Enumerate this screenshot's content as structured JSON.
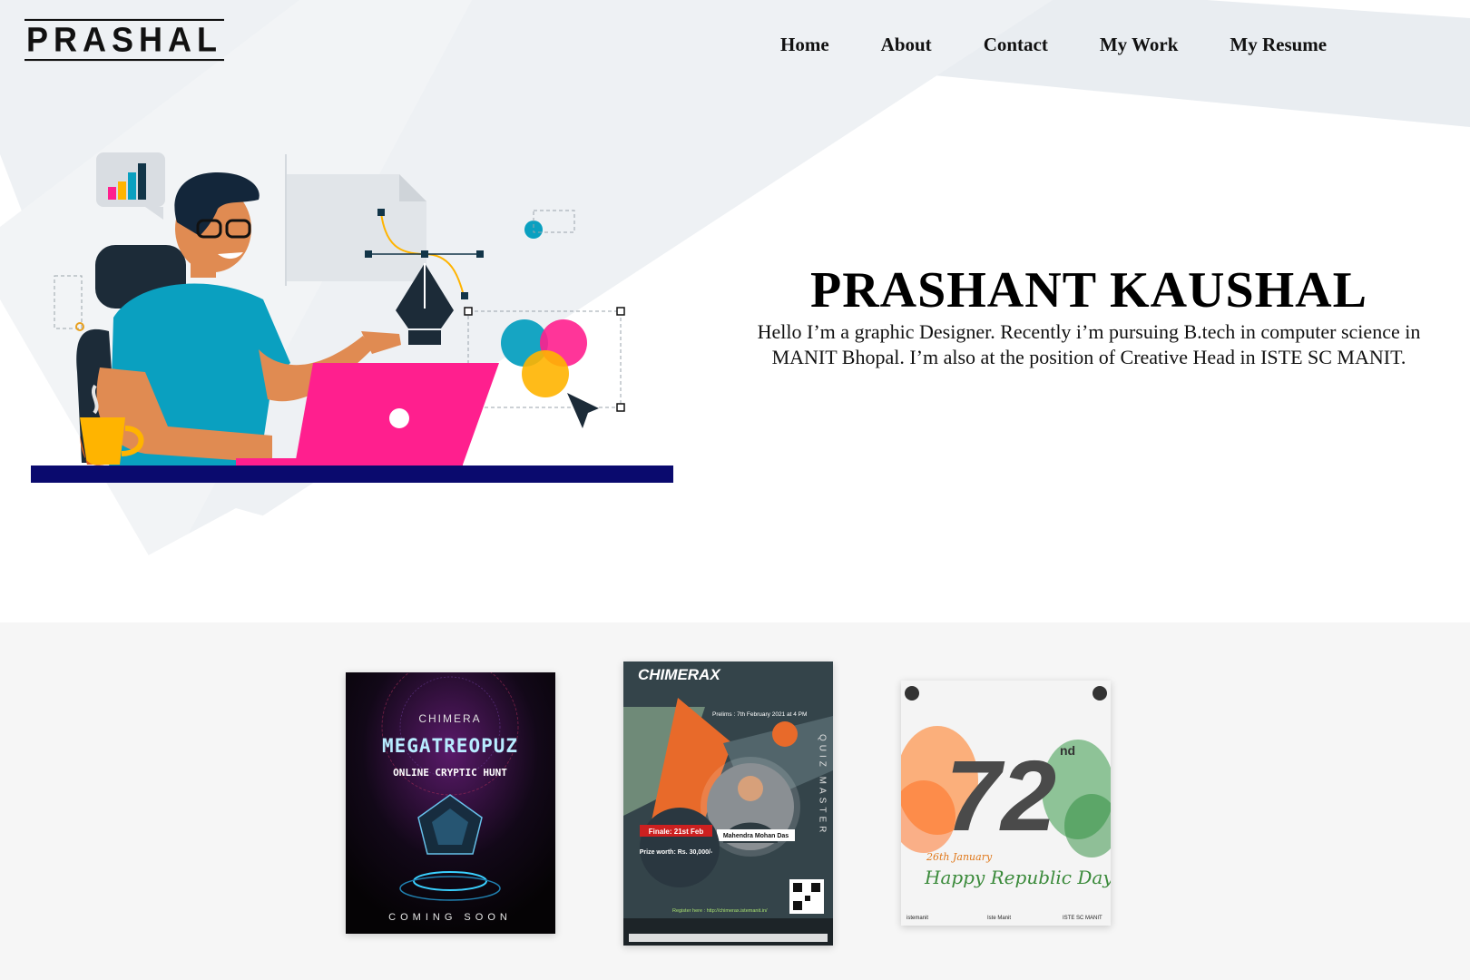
{
  "brand": {
    "logo": "PRASHAL"
  },
  "nav": {
    "items": [
      "Home",
      "About",
      "Contact",
      "My Work",
      "My Resume"
    ]
  },
  "hero": {
    "title": "PRASHANT KAUSHAL",
    "description": "Hello I’m a graphic Designer. Recently i’m pursuing B.tech in computer science in MANIT Bhopal. I’m also at the position of Creative Head in ISTE SC MANIT."
  },
  "gallery": {
    "items": [
      {
        "alt": "Chimera MegaTreoPuz poster",
        "event": "CHIMERA",
        "title": "MEGATREOPUZ",
        "subtitle": "ONLINE CRYPTIC HUNT",
        "footer": "COMING SOON"
      },
      {
        "alt": "ChimeraX Quiz Master poster",
        "event": "CHIMERAX",
        "prelims": "Prelims : 7th February 2021 at 4 PM",
        "vertical": "QUIZ MASTER",
        "finale": "Finale: 21st Feb",
        "prize": "Prize worth: Rs. 30,000/-",
        "speaker": "Mahendra Mohan Das",
        "register": "Register here : http://chimerax.istemanit.in/"
      },
      {
        "alt": "72nd Republic Day poster",
        "number": "72",
        "suffix": "nd",
        "date": "26th January",
        "greeting": "Happy Republic Day",
        "handles": [
          "istemanit",
          "Iste Manit",
          "ISTE SC MANIT"
        ]
      }
    ]
  },
  "colors": {
    "accent_pink": "#ff1f8e",
    "accent_teal": "#0aa0c0",
    "accent_yellow": "#ffb400",
    "navy": "#0a0a6e"
  }
}
